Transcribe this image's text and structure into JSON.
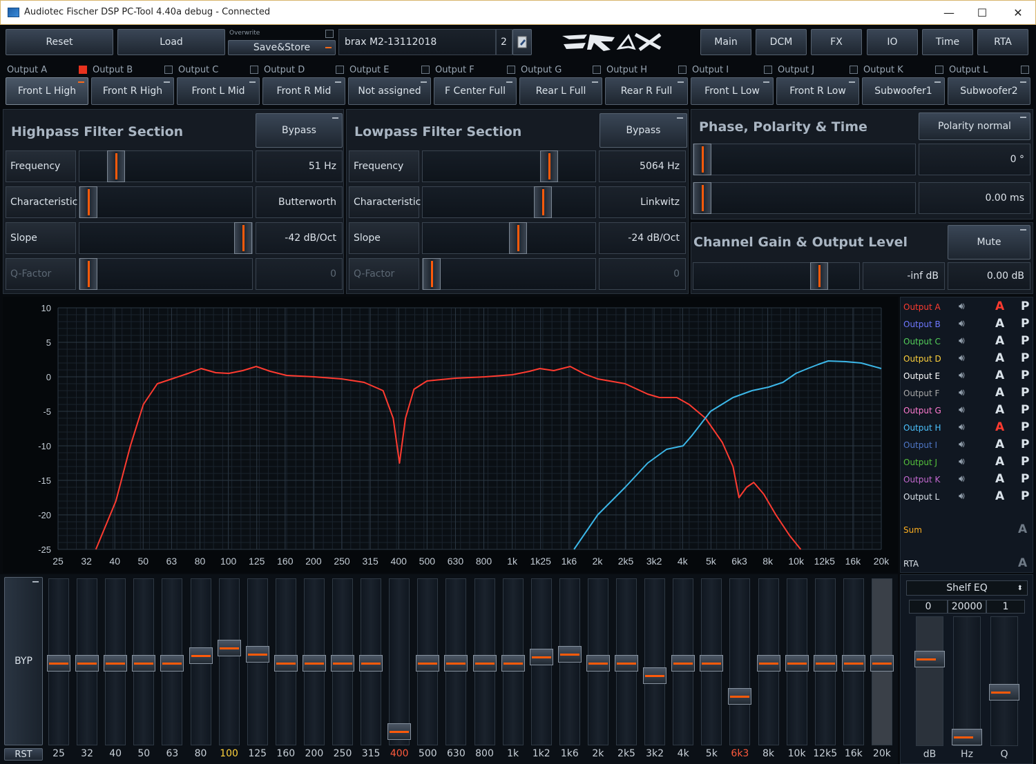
{
  "window": {
    "title": "Audiotec Fischer DSP PC-Tool 4.40a debug - Connected",
    "minimize": "—",
    "maximize": "☐",
    "close": "✕"
  },
  "toolbar": {
    "reset": "Reset",
    "load": "Load",
    "overwrite_label": "Overwrite",
    "save_store": "Save&Store",
    "preset_name": "brax M2-13112018",
    "preset_slot": "2",
    "logo_text": "BRAX"
  },
  "nav": [
    "Main",
    "DCM",
    "FX",
    "IO",
    "Time",
    "RTA"
  ],
  "outputs": [
    {
      "label": "Output A",
      "assign": "Front L High",
      "checked": true
    },
    {
      "label": "Output B",
      "assign": "Front R High",
      "checked": false
    },
    {
      "label": "Output C",
      "assign": "Front L Mid",
      "checked": false
    },
    {
      "label": "Output D",
      "assign": "Front R Mid",
      "checked": false
    },
    {
      "label": "Output E",
      "assign": "Not assigned",
      "checked": false
    },
    {
      "label": "Output F",
      "assign": "F Center Full",
      "checked": false
    },
    {
      "label": "Output G",
      "assign": "Rear L Full",
      "checked": false
    },
    {
      "label": "Output H",
      "assign": "Rear R Full",
      "checked": false
    },
    {
      "label": "Output I",
      "assign": "Front L Low",
      "checked": false
    },
    {
      "label": "Output J",
      "assign": "Front R Low",
      "checked": false
    },
    {
      "label": "Output K",
      "assign": "Subwoofer1",
      "checked": false
    },
    {
      "label": "Output L",
      "assign": "Subwoofer2",
      "checked": false
    }
  ],
  "highpass": {
    "title": "Highpass Filter Section",
    "bypass": "Bypass",
    "rows": [
      {
        "label": "Frequency",
        "value": "51 Hz",
        "pos": 0.18
      },
      {
        "label": "Characteristic",
        "value": "Butterworth",
        "pos": 0.0
      },
      {
        "label": "Slope",
        "value": "-42 dB/Oct",
        "pos": 1.0
      },
      {
        "label": "Q-Factor",
        "value": "0",
        "pos": 0.0
      }
    ]
  },
  "lowpass": {
    "title": "Lowpass Filter Section",
    "bypass": "Bypass",
    "rows": [
      {
        "label": "Frequency",
        "value": "5064 Hz",
        "pos": 0.76
      },
      {
        "label": "Characteristic",
        "value": "Linkwitz",
        "pos": 0.72
      },
      {
        "label": "Slope",
        "value": "-24 dB/Oct",
        "pos": 0.56
      },
      {
        "label": "Q-Factor",
        "value": "0",
        "pos": 0.0
      }
    ]
  },
  "phase": {
    "title": "Phase, Polarity & Time",
    "polarity": "Polarity normal",
    "phase_value": "0 °",
    "delay_value": "0.00 ms",
    "phase_pos": 0.0,
    "delay_pos": 0.0
  },
  "gain": {
    "title": "Channel Gain & Output Level",
    "mute": "Mute",
    "gain_value": "-inf dB",
    "level_value": "0.00 dB",
    "gain_pos": 0.79
  },
  "graph": {
    "y_ticks": [
      "10",
      "5",
      "0",
      "-5",
      "-10",
      "-15",
      "-20",
      "-25"
    ],
    "x_ticks": [
      "25",
      "32",
      "40",
      "50",
      "63",
      "80",
      "100",
      "125",
      "160",
      "200",
      "250",
      "315",
      "400",
      "500",
      "630",
      "800",
      "1k",
      "1k25",
      "1k6",
      "2k",
      "2k5",
      "3k2",
      "4k",
      "5k",
      "6k3",
      "8k",
      "10k",
      "12k5",
      "16k",
      "20k"
    ],
    "red_curve": [
      [
        34,
        -25
      ],
      [
        40,
        -18
      ],
      [
        45,
        -10
      ],
      [
        50,
        -4
      ],
      [
        56,
        -1
      ],
      [
        63,
        -0.3
      ],
      [
        72,
        0.5
      ],
      [
        80,
        1.2
      ],
      [
        90,
        0.6
      ],
      [
        100,
        0.5
      ],
      [
        112,
        0.9
      ],
      [
        125,
        1.5
      ],
      [
        140,
        0.8
      ],
      [
        160,
        0.2
      ],
      [
        200,
        0
      ],
      [
        250,
        -0.3
      ],
      [
        300,
        -0.8
      ],
      [
        350,
        -2
      ],
      [
        380,
        -6
      ],
      [
        400,
        -12.5
      ],
      [
        420,
        -6
      ],
      [
        450,
        -1.8
      ],
      [
        500,
        -0.6
      ],
      [
        630,
        -0.2
      ],
      [
        800,
        0
      ],
      [
        1000,
        0.3
      ],
      [
        1150,
        0.8
      ],
      [
        1250,
        1.2
      ],
      [
        1400,
        0.9
      ],
      [
        1600,
        1.5
      ],
      [
        1800,
        0.4
      ],
      [
        2000,
        -0.3
      ],
      [
        2500,
        -1
      ],
      [
        3000,
        -2.5
      ],
      [
        3300,
        -3
      ],
      [
        3800,
        -3
      ],
      [
        4200,
        -4
      ],
      [
        4800,
        -6
      ],
      [
        5500,
        -9.5
      ],
      [
        6000,
        -13
      ],
      [
        6300,
        -17.5
      ],
      [
        6700,
        -16
      ],
      [
        7100,
        -15.3
      ],
      [
        7700,
        -17
      ],
      [
        8500,
        -20
      ],
      [
        9500,
        -23
      ],
      [
        10400,
        -25
      ]
    ],
    "blue_curve": [
      [
        1650,
        -25
      ],
      [
        2000,
        -20
      ],
      [
        2500,
        -16
      ],
      [
        3000,
        -12.5
      ],
      [
        3500,
        -10.5
      ],
      [
        4000,
        -10
      ],
      [
        4300,
        -8.5
      ],
      [
        5000,
        -5
      ],
      [
        6000,
        -3
      ],
      [
        7000,
        -2
      ],
      [
        8000,
        -1.5
      ],
      [
        9000,
        -0.8
      ],
      [
        10000,
        0.5
      ],
      [
        11000,
        1.2
      ],
      [
        12000,
        1.8
      ],
      [
        13000,
        2.3
      ],
      [
        15000,
        2.2
      ],
      [
        17000,
        2
      ],
      [
        20000,
        1.2
      ]
    ]
  },
  "legend": {
    "rows": [
      {
        "label": "Output A",
        "color": "#ff3b30",
        "a_color": "#ff3b30"
      },
      {
        "label": "Output B",
        "color": "#6f78ff",
        "a_color": "#dbe3ea"
      },
      {
        "label": "Output C",
        "color": "#54d05a",
        "a_color": "#dbe3ea"
      },
      {
        "label": "Output D",
        "color": "#ffd23c",
        "a_color": "#dbe3ea"
      },
      {
        "label": "Output E",
        "color": "#ffffff",
        "a_color": "#dbe3ea"
      },
      {
        "label": "Output F",
        "color": "#a8a8a8",
        "a_color": "#dbe3ea"
      },
      {
        "label": "Output G",
        "color": "#ff7bd0",
        "a_color": "#dbe3ea"
      },
      {
        "label": "Output H",
        "color": "#4cc3ff",
        "a_color": "#ff3b30"
      },
      {
        "label": "Output I",
        "color": "#4f78c8",
        "a_color": "#dbe3ea"
      },
      {
        "label": "Output J",
        "color": "#55c23c",
        "a_color": "#dbe3ea"
      },
      {
        "label": "Output K",
        "color": "#c66ad2",
        "a_color": "#dbe3ea"
      },
      {
        "label": "Output L",
        "color": "#dbe3ea",
        "a_color": "#dbe3ea"
      }
    ],
    "a": "A",
    "p": "P",
    "sum": "Sum",
    "rta": "RTA"
  },
  "eq": {
    "byp": "BYP",
    "rst": "RST",
    "bands": [
      {
        "label": "25",
        "gain": 0.5,
        "color": "#c8d0d8"
      },
      {
        "label": "32",
        "gain": 0.5,
        "color": "#c8d0d8"
      },
      {
        "label": "40",
        "gain": 0.5,
        "color": "#c8d0d8"
      },
      {
        "label": "50",
        "gain": 0.5,
        "color": "#c8d0d8"
      },
      {
        "label": "63",
        "gain": 0.5,
        "color": "#c8d0d8"
      },
      {
        "label": "80",
        "gain": 0.55,
        "color": "#c8d0d8"
      },
      {
        "label": "100",
        "gain": 0.6,
        "color": "#ffd23c"
      },
      {
        "label": "125",
        "gain": 0.56,
        "color": "#c8d0d8"
      },
      {
        "label": "160",
        "gain": 0.5,
        "color": "#c8d0d8"
      },
      {
        "label": "200",
        "gain": 0.5,
        "color": "#c8d0d8"
      },
      {
        "label": "250",
        "gain": 0.5,
        "color": "#c8d0d8"
      },
      {
        "label": "315",
        "gain": 0.5,
        "color": "#c8d0d8"
      },
      {
        "label": "400",
        "gain": 0.05,
        "color": "#ff5a3c"
      },
      {
        "label": "500",
        "gain": 0.5,
        "color": "#c8d0d8"
      },
      {
        "label": "630",
        "gain": 0.5,
        "color": "#c8d0d8"
      },
      {
        "label": "800",
        "gain": 0.5,
        "color": "#c8d0d8"
      },
      {
        "label": "1k",
        "gain": 0.5,
        "color": "#c8d0d8"
      },
      {
        "label": "1k2",
        "gain": 0.54,
        "color": "#c8d0d8"
      },
      {
        "label": "1k6",
        "gain": 0.56,
        "color": "#c8d0d8"
      },
      {
        "label": "2k",
        "gain": 0.5,
        "color": "#c8d0d8"
      },
      {
        "label": "2k5",
        "gain": 0.5,
        "color": "#c8d0d8"
      },
      {
        "label": "3k2",
        "gain": 0.42,
        "color": "#c8d0d8"
      },
      {
        "label": "4k",
        "gain": 0.5,
        "color": "#c8d0d8"
      },
      {
        "label": "5k",
        "gain": 0.5,
        "color": "#c8d0d8"
      },
      {
        "label": "6k3",
        "gain": 0.28,
        "color": "#ff5a3c"
      },
      {
        "label": "8k",
        "gain": 0.5,
        "color": "#c8d0d8"
      },
      {
        "label": "10k",
        "gain": 0.5,
        "color": "#c8d0d8"
      },
      {
        "label": "12k5",
        "gain": 0.5,
        "color": "#c8d0d8"
      },
      {
        "label": "16k",
        "gain": 0.5,
        "color": "#c8d0d8"
      },
      {
        "label": "20k",
        "gain": 0.5,
        "color": "#c8d0d8"
      }
    ]
  },
  "shelf": {
    "mode": "Shelf EQ",
    "db": "0",
    "hz": "20000",
    "q": "1",
    "db_label": "dB",
    "hz_label": "Hz",
    "q_label": "Q",
    "db_pos": 0.7,
    "hz_pos": 0.0,
    "q_pos": 0.4
  }
}
